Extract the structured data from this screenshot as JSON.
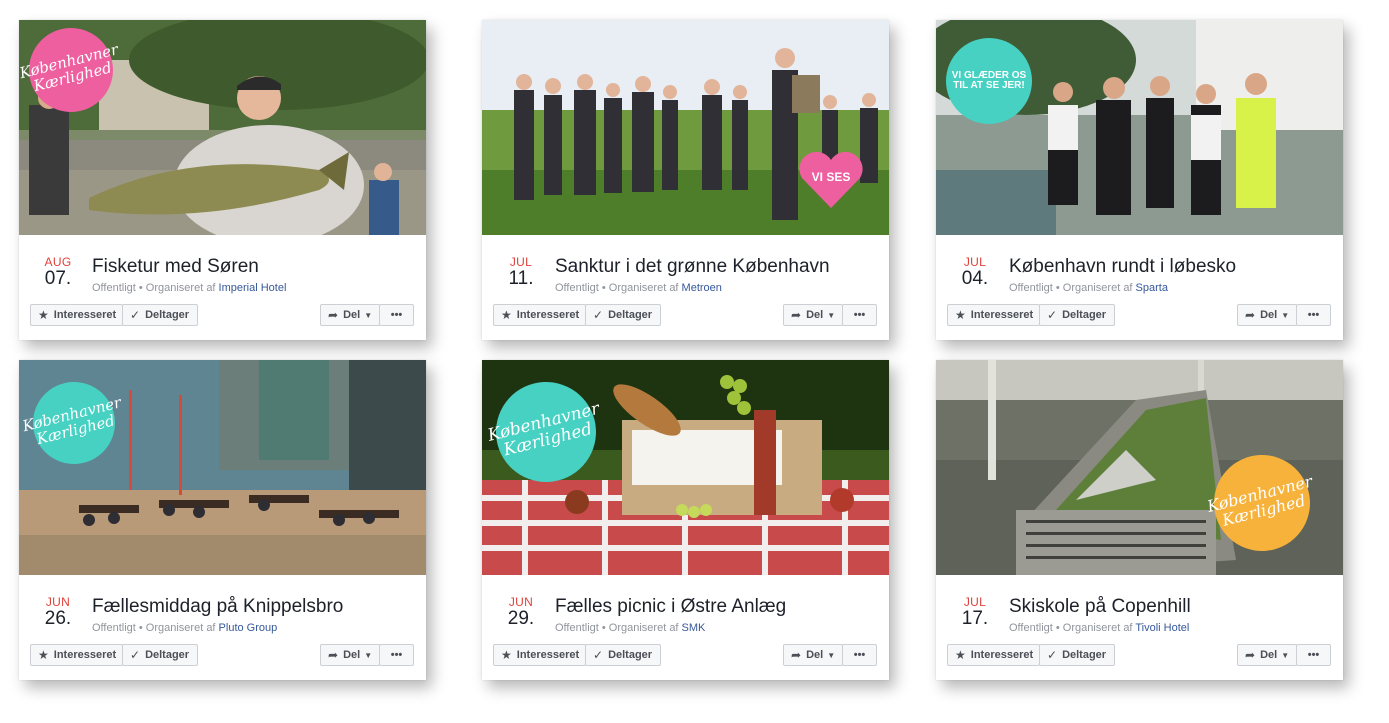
{
  "colors": {
    "month": "#e0413a",
    "link": "#365899",
    "meta": "#90949c",
    "pink": "#ee5fa0",
    "teal": "#46d1c2",
    "orange": "#f7b23b"
  },
  "labels": {
    "interested": "Interesseret",
    "going": "Deltager",
    "share": "Del",
    "more": "•••",
    "meta_prefix": "Offentligt • Organiseret af "
  },
  "events": [
    {
      "month": "AUG",
      "day": "07.",
      "title": "Fisketur med Søren",
      "organizer": "Imperial Hotel",
      "badge": [
        "Københavner",
        "Kærlighed"
      ],
      "badge_color": "pink"
    },
    {
      "month": "JUL",
      "day": "11.",
      "title": "Sanktur i det grønne København",
      "organizer": "Metroen",
      "badge": [
        "VI SES"
      ],
      "badge_color": "pink"
    },
    {
      "month": "JUL",
      "day": "04.",
      "title": "København rundt i løbesko",
      "organizer": "Sparta",
      "badge": [
        "VI GLÆDER OS",
        "TIL AT SE JER!"
      ],
      "badge_color": "teal"
    },
    {
      "month": "JUN",
      "day": "26.",
      "title": "Fællesmiddag på Knippelsbro",
      "organizer": "Pluto Group",
      "badge": [
        "Københavner",
        "Kærlighed"
      ],
      "badge_color": "teal"
    },
    {
      "month": "JUN",
      "day": "29.",
      "title": "Fælles picnic i Østre Anlæg",
      "organizer": "SMK",
      "badge": [
        "Københavner",
        "Kærlighed"
      ],
      "badge_color": "teal"
    },
    {
      "month": "JUL",
      "day": "17.",
      "title": "Skiskole på Copenhill",
      "organizer": "Tivoli Hotel",
      "badge": [
        "Københavner",
        "Kærlighed"
      ],
      "badge_color": "orange"
    }
  ]
}
